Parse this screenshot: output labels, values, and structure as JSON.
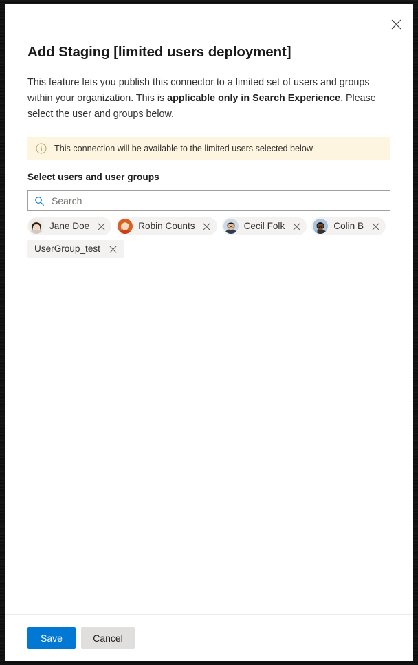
{
  "dialog": {
    "title": "Add Staging [limited users deployment]",
    "description_part1": "This feature lets you publish this connector to a limited set of users and groups within your organization. This is ",
    "description_bold": "applicable only in Search Experience",
    "description_part2": ". Please select the user and groups below.",
    "close_label": "Close"
  },
  "info_banner": {
    "icon": "info-circle-icon",
    "text": "This connection will be available to the limited users selected below",
    "background_color": "#fdf5e0"
  },
  "people_picker": {
    "label": "Select users and user groups",
    "search": {
      "icon": "search-icon",
      "value": "",
      "placeholder": "Search"
    },
    "selected": [
      {
        "name": "Jane Doe",
        "type": "person",
        "avatar": "jane-doe-avatar",
        "remove_label": "Remove Jane Doe",
        "avatar_colors": {
          "bg": "#f0ece6",
          "hair": "#1d1a17",
          "skin": "#f3d5bd",
          "shirt": "#cfcac3"
        }
      },
      {
        "name": "Robin Counts",
        "type": "person",
        "avatar": "robin-counts-avatar",
        "remove_label": "Remove Robin Counts",
        "avatar_colors": {
          "bg": "#d9601f",
          "hair": "#efe3cd",
          "skin": "#f6d8bd",
          "shirt": "#c7401a"
        }
      },
      {
        "name": "Cecil Folk",
        "type": "person",
        "avatar": "cecil-folk-avatar",
        "remove_label": "Remove Cecil Folk",
        "avatar_colors": {
          "bg": "#cdd9e3",
          "hair": "#15161a",
          "skin": "#e8bd96",
          "shirt": "#2c3b52"
        }
      },
      {
        "name": "Colin B",
        "type": "person",
        "avatar": "colin-b-avatar",
        "remove_label": "Remove Colin B",
        "avatar_colors": {
          "bg": "#a9c6de",
          "hair": "#120f0e",
          "skin": "#7a4a2c",
          "shirt": "#35302c"
        }
      },
      {
        "name": "UserGroup_test",
        "type": "group",
        "avatar": "",
        "remove_label": "Remove UserGroup_test",
        "avatar_colors": null
      }
    ]
  },
  "footer": {
    "save_label": "Save",
    "cancel_label": "Cancel",
    "primary_color": "#0078d4",
    "secondary_color": "#e1dfdd"
  }
}
